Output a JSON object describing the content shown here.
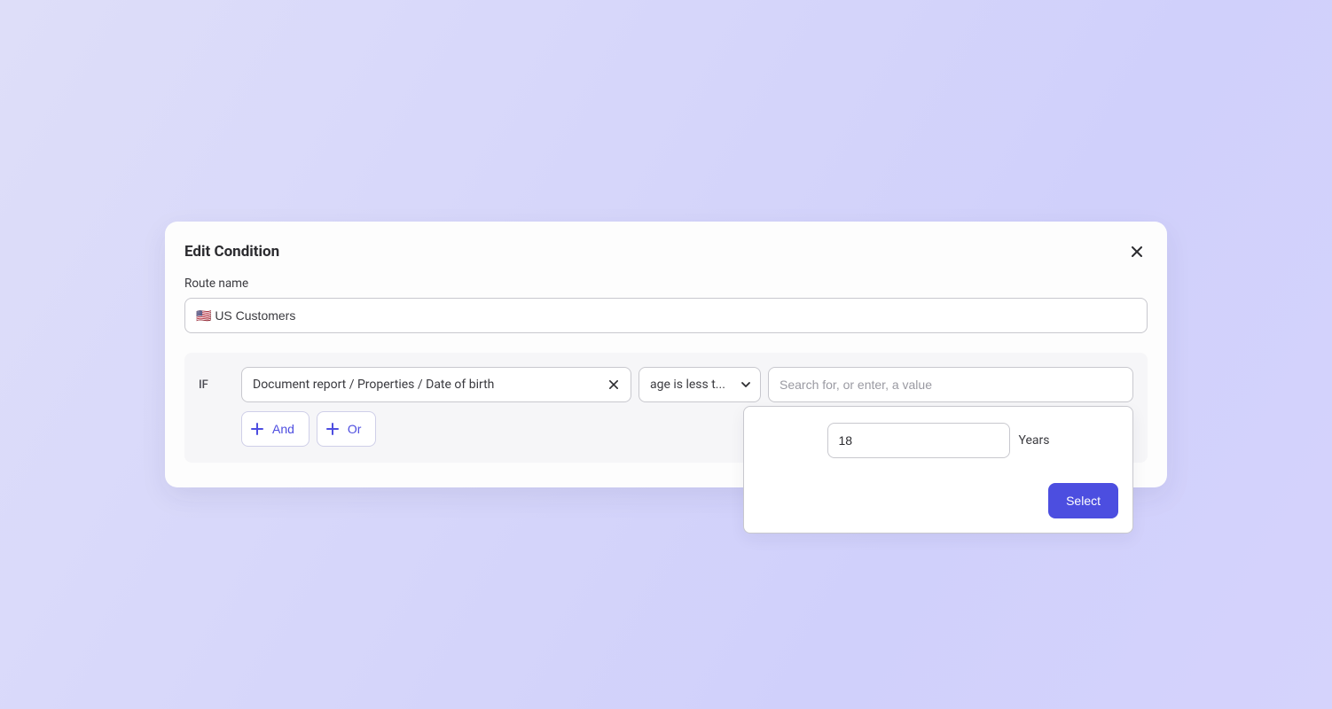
{
  "dialog": {
    "title": "Edit Condition",
    "route_label": "Route name",
    "route_value": "🇺🇸 US Customers"
  },
  "condition": {
    "if_label": "IF",
    "property": "Document report / Properties / Date of birth",
    "operator": "age is less t...",
    "value_placeholder": "Search for, or enter, a value",
    "and_label": "And",
    "or_label": "Or"
  },
  "age_panel": {
    "value": "18",
    "unit": "Years",
    "select_label": "Select"
  }
}
